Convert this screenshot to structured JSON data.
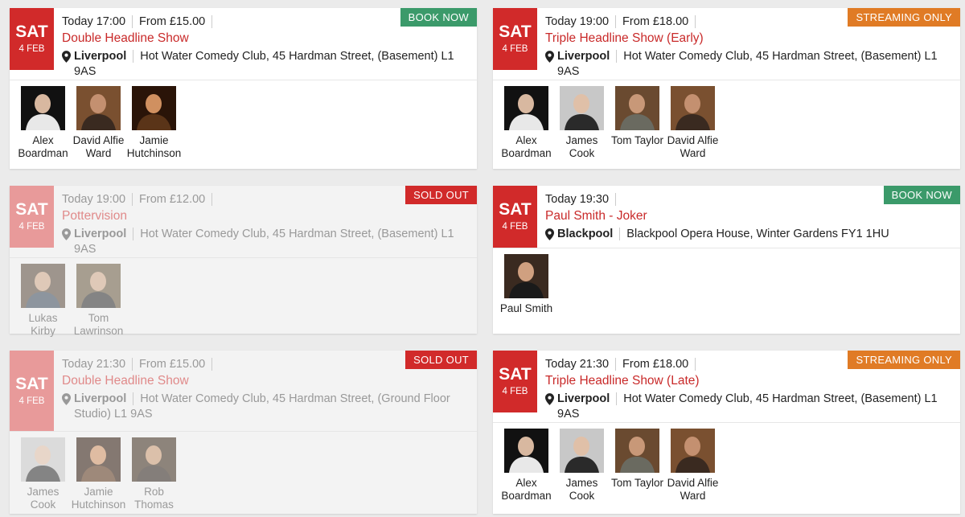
{
  "events": [
    {
      "day": "SAT",
      "date": "4 FEB",
      "time": "Today 17:00",
      "price": "From £15.00",
      "title": "Double Headline Show",
      "city": "Liverpool",
      "address": "Hot Water Comedy Club, 45 Hardman Street, (Basement) L1 9AS",
      "badge": "BOOK NOW",
      "badge_type": "book",
      "acts": [
        {
          "name": "Alex Boardman",
          "photo_bg": "#111111",
          "shirt": "#e8e8e8",
          "skin": "#d8b8a0"
        },
        {
          "name": "David Alfie Ward",
          "photo_bg": "#7a5030",
          "shirt": "#3a2a20",
          "skin": "#c49070"
        },
        {
          "name": "Jamie Hutchinson",
          "photo_bg": "#2a1408",
          "shirt": "#5a3418",
          "skin": "#d09060"
        }
      ]
    },
    {
      "day": "SAT",
      "date": "4 FEB",
      "time": "Today 19:00",
      "price": "From £18.00",
      "title": "Triple Headline Show (Early)",
      "city": "Liverpool",
      "address": "Hot Water Comedy Club, 45 Hardman Street, (Basement) L1 9AS",
      "badge": "STREAMING ONLY",
      "badge_type": "stream",
      "acts": [
        {
          "name": "Alex Boardman",
          "photo_bg": "#111111",
          "shirt": "#e8e8e8",
          "skin": "#d8b8a0"
        },
        {
          "name": "James Cook",
          "photo_bg": "#c8c8c8",
          "shirt": "#2a2a2a",
          "skin": "#e0c0a8"
        },
        {
          "name": "Tom Taylor",
          "photo_bg": "#6a4a30",
          "shirt": "#6a6a60",
          "skin": "#c89878"
        },
        {
          "name": "David Alfie Ward",
          "photo_bg": "#7a5030",
          "shirt": "#3a2a20",
          "skin": "#c49070"
        }
      ]
    },
    {
      "day": "SAT",
      "date": "4 FEB",
      "time": "Today 19:00",
      "price": "From £12.00",
      "title": "Pottervision",
      "city": "Liverpool",
      "address": "Hot Water Comedy Club, 45 Hardman Street, (Basement) L1 9AS",
      "badge": "SOLD OUT",
      "badge_type": "sold",
      "acts": [
        {
          "name": "Lukas Kirby",
          "photo_bg": "#5a4a3a",
          "shirt": "#3a4a5a",
          "skin": "#d0a888"
        },
        {
          "name": "Tom Lawrinson",
          "photo_bg": "#6a5a40",
          "shirt": "#2a2a2a",
          "skin": "#d0a888"
        }
      ],
      "disabled": true
    },
    {
      "day": "SAT",
      "date": "4 FEB",
      "time": "Today 19:30",
      "price": "",
      "title": "Paul Smith - Joker",
      "city": "Blackpool",
      "address": "Blackpool Opera House, Winter Gardens FY1 1HU",
      "badge": "BOOK NOW",
      "badge_type": "book",
      "acts": [
        {
          "name": "Paul Smith",
          "photo_bg": "#3a2a20",
          "shirt": "#1a1a1a",
          "skin": "#d0a080"
        }
      ]
    },
    {
      "day": "SAT",
      "date": "4 FEB",
      "time": "Today 21:30",
      "price": "From £15.00",
      "title": "Double Headline Show",
      "city": "Liverpool",
      "address": "Hot Water Comedy Club, 45 Hardman Street, (Ground Floor Studio) L1 9AS",
      "badge": "SOLD OUT",
      "badge_type": "sold",
      "acts": [
        {
          "name": "James Cook",
          "photo_bg": "#c8c8c8",
          "shirt": "#2a2a2a",
          "skin": "#e0c0a8"
        },
        {
          "name": "Jamie Hutchinson",
          "photo_bg": "#2a1408",
          "shirt": "#5a3418",
          "skin": "#d09060"
        },
        {
          "name": "Rob Thomas",
          "photo_bg": "#3a2a1a",
          "shirt": "#2a2018",
          "skin": "#c89870"
        }
      ],
      "disabled": true
    },
    {
      "day": "SAT",
      "date": "4 FEB",
      "time": "Today 21:30",
      "price": "From £18.00",
      "title": "Triple Headline Show (Late)",
      "city": "Liverpool",
      "address": "Hot Water Comedy Club, 45 Hardman Street, (Basement) L1 9AS",
      "badge": "STREAMING ONLY",
      "badge_type": "stream",
      "acts": [
        {
          "name": "Alex Boardman",
          "photo_bg": "#111111",
          "shirt": "#e8e8e8",
          "skin": "#d8b8a0"
        },
        {
          "name": "James Cook",
          "photo_bg": "#c8c8c8",
          "shirt": "#2a2a2a",
          "skin": "#e0c0a8"
        },
        {
          "name": "Tom Taylor",
          "photo_bg": "#6a4a30",
          "shirt": "#6a6a60",
          "skin": "#c89878"
        },
        {
          "name": "David Alfie Ward",
          "photo_bg": "#7a5030",
          "shirt": "#3a2a20",
          "skin": "#c49070"
        }
      ]
    }
  ],
  "icons": {
    "location": "map-pin-icon"
  },
  "colors": {
    "accent": "#d12a2a",
    "book": "#3b9a6a",
    "stream": "#e07b25",
    "sold": "#d12a2a"
  }
}
